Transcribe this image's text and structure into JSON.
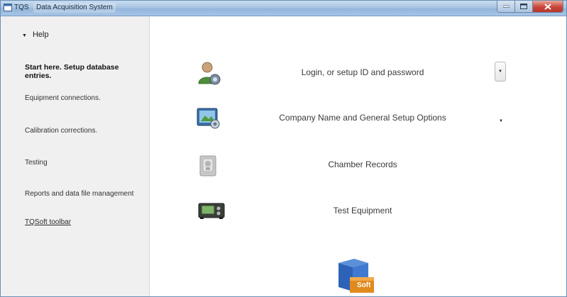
{
  "window": {
    "app_name": "TQS",
    "title": "Data Acquisition System"
  },
  "sidebar": {
    "help_label": "Help",
    "items": [
      {
        "label": "Start here. Setup database entries.",
        "style": "bold"
      },
      {
        "label": "Equipment connections."
      },
      {
        "label": "Calibration corrections."
      },
      {
        "label": "Testing"
      },
      {
        "label": "Reports and data file management"
      },
      {
        "label": "TQSoft toolbar",
        "style": "link"
      }
    ]
  },
  "main": {
    "rows": [
      {
        "label": "Login, or setup ID and password",
        "icon": "user-key-icon",
        "dropdown": "boxed"
      },
      {
        "label": "Company Name and General Setup Options",
        "icon": "setup-options-icon",
        "dropdown": "plain"
      },
      {
        "label": "Chamber Records",
        "icon": "chamber-icon"
      },
      {
        "label": "Test Equipment",
        "icon": "test-equipment-icon"
      }
    ],
    "logo_text": "Soft"
  },
  "colors": {
    "titlebar": "#a9c5e3",
    "sidebar_bg": "#f0f0f0",
    "close_button": "#c9463a",
    "logo_blue": "#2c63b8",
    "logo_orange": "#e08a1e"
  }
}
